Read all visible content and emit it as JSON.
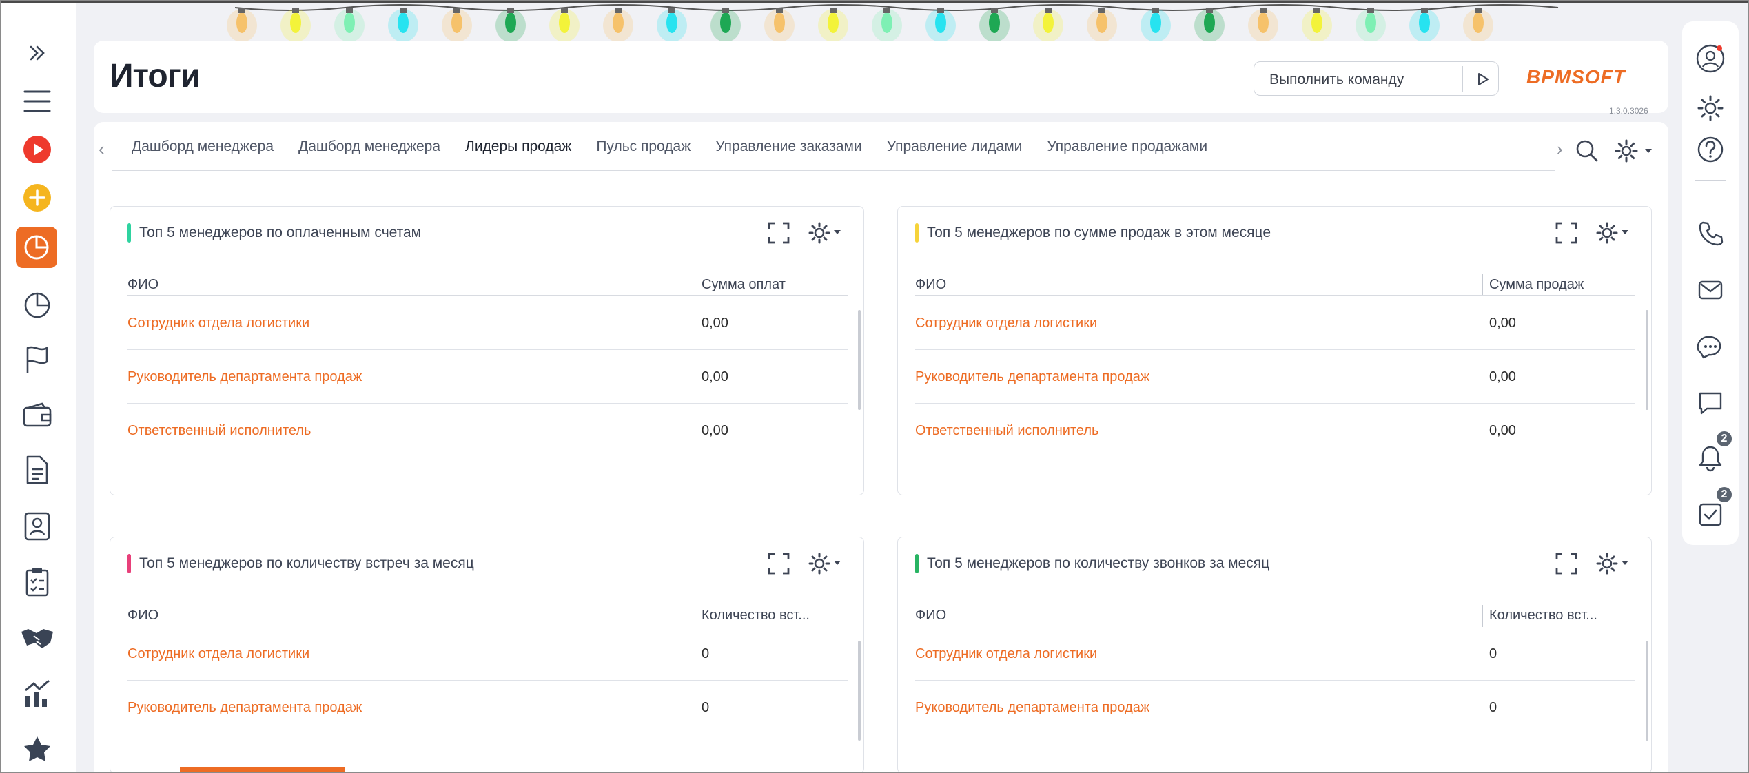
{
  "header": {
    "title": "Итоги",
    "command_placeholder": "Выполнить команду",
    "logo_text": "BPMSOFT",
    "version": "1.3.0.3026"
  },
  "tabs": [
    "Дашборд менеджера",
    "Дашборд менеджера",
    "Лидеры продаж",
    "Пульс продаж",
    "Управление заказами",
    "Управление лидами",
    "Управление продажами"
  ],
  "active_tab": "Лидеры продаж",
  "widgets": [
    {
      "title": "Топ 5 менеджеров по оплаченным счетам",
      "accent": "#2fd3a0",
      "col_name": "ФИО",
      "col_value": "Сумма оплат",
      "rows": [
        {
          "name": "Сотрудник отдела логистики",
          "value": "0,00"
        },
        {
          "name": "Руководитель департамента продаж",
          "value": "0,00"
        },
        {
          "name": "Ответственный исполнитель",
          "value": "0,00"
        }
      ]
    },
    {
      "title": "Топ 5 менеджеров по сумме продаж в этом месяце",
      "accent": "#f6d33a",
      "col_name": "ФИО",
      "col_value": "Сумма продаж",
      "rows": [
        {
          "name": "Сотрудник отдела логистики",
          "value": "0,00"
        },
        {
          "name": "Руководитель департамента продаж",
          "value": "0,00"
        },
        {
          "name": "Ответственный исполнитель",
          "value": "0,00"
        }
      ]
    },
    {
      "title": "Топ 5 менеджеров по количеству встреч за месяц",
      "accent": "#e8407a",
      "col_name": "ФИО",
      "col_value": "Количество вст...",
      "rows": [
        {
          "name": "Сотрудник отдела логистики",
          "value": "0"
        },
        {
          "name": "Руководитель департамента продаж",
          "value": "0"
        }
      ]
    },
    {
      "title": "Топ 5 менеджеров по количеству звонков за месяц",
      "accent": "#28b463",
      "col_name": "ФИО",
      "col_value": "Количество вст...",
      "rows": [
        {
          "name": "Сотрудник отдела логистики",
          "value": "0"
        },
        {
          "name": "Руководитель департамента продаж",
          "value": "0"
        }
      ]
    }
  ],
  "sidebar_left": [
    "expand-icon",
    "menu-icon",
    "play-icon",
    "add-icon",
    "dashboards-icon",
    "analytics-icon",
    "flag-icon",
    "wallet-icon",
    "document-icon",
    "contacts-icon",
    "tasks-icon",
    "handshake-icon",
    "chart-icon",
    "star-icon"
  ],
  "sidebar_right": {
    "notifications_count": "2",
    "tasks_count": "2"
  },
  "colors": {
    "accent": "#ed6c24",
    "brand": "#ed6c24",
    "link": "#ed6c24"
  }
}
